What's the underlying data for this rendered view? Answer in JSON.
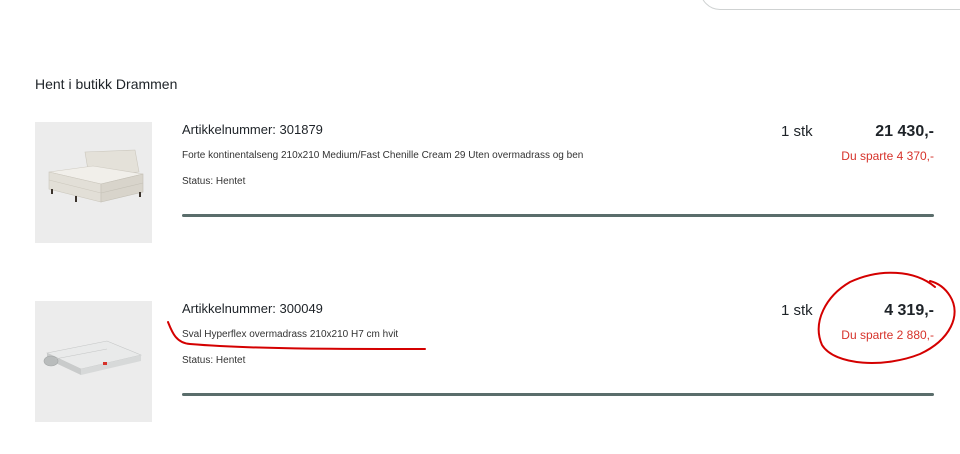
{
  "pickup": {
    "title": "Hent i butikk Drammen"
  },
  "items": [
    {
      "article": "Artikkelnummer: 301879",
      "description": "Forte kontinentalseng 210x210 Medium/Fast Chenille Cream 29 Uten overmadrass og ben",
      "status": "Status: Hentet",
      "quantity": "1 stk",
      "price": "21 430,-",
      "saved": "Du sparte 4 370,-",
      "progress": 1.0,
      "image_icon": "bed-icon"
    },
    {
      "article": "Artikkelnummer: 300049",
      "description": "Sval Hyperflex overmadrass 210x210 H7 cm hvit",
      "status": "Status: Hentet",
      "quantity": "1 stk",
      "price": "4 319,-",
      "saved": "Du sparte 2 880,-",
      "progress": 1.0,
      "image_icon": "mattress-topper-icon"
    }
  ],
  "colors": {
    "saved_text": "#d6322a",
    "progress_fill": "#5a6d6b",
    "annotation": "#d40000"
  }
}
